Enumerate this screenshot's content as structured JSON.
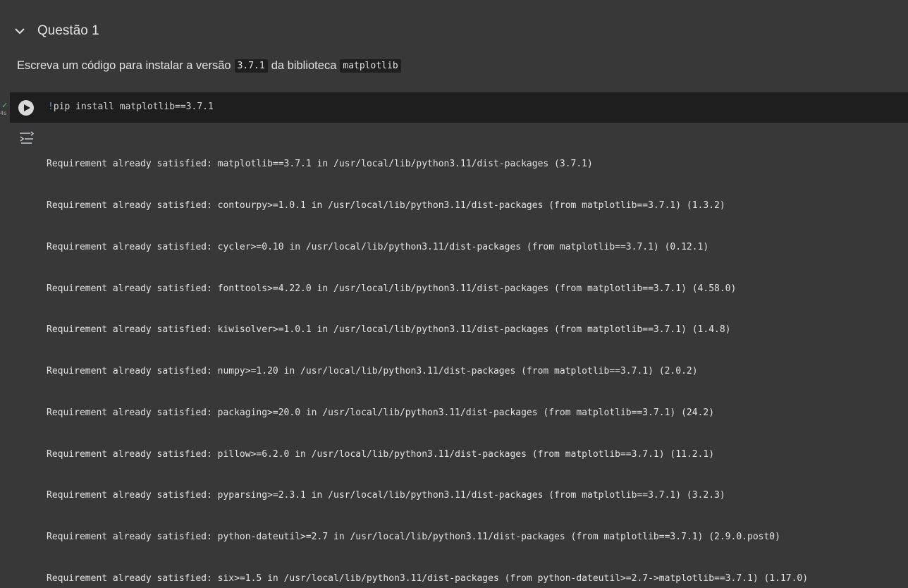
{
  "section": {
    "title": "Questão 1",
    "chevron_icon": "chevron-down-icon"
  },
  "text_cell": {
    "prefix": "Escreva um código para instalar a versão",
    "version_code": "3.7.1",
    "middle": "da biblioteca",
    "library_code": "matplotlib"
  },
  "execution": {
    "status_icon": "check-icon",
    "duration": "4s"
  },
  "code_cell": {
    "run_icon": "play-circle-icon",
    "bang": "!",
    "command": "pip install matplotlib==3.7.1"
  },
  "output": {
    "icon": "output-toggle-icon",
    "lines": [
      "Requirement already satisfied: matplotlib==3.7.1 in /usr/local/lib/python3.11/dist-packages (3.7.1)",
      "Requirement already satisfied: contourpy>=1.0.1 in /usr/local/lib/python3.11/dist-packages (from matplotlib==3.7.1) (1.3.2)",
      "Requirement already satisfied: cycler>=0.10 in /usr/local/lib/python3.11/dist-packages (from matplotlib==3.7.1) (0.12.1)",
      "Requirement already satisfied: fonttools>=4.22.0 in /usr/local/lib/python3.11/dist-packages (from matplotlib==3.7.1) (4.58.0)",
      "Requirement already satisfied: kiwisolver>=1.0.1 in /usr/local/lib/python3.11/dist-packages (from matplotlib==3.7.1) (1.4.8)",
      "Requirement already satisfied: numpy>=1.20 in /usr/local/lib/python3.11/dist-packages (from matplotlib==3.7.1) (2.0.2)",
      "Requirement already satisfied: packaging>=20.0 in /usr/local/lib/python3.11/dist-packages (from matplotlib==3.7.1) (24.2)",
      "Requirement already satisfied: pillow>=6.2.0 in /usr/local/lib/python3.11/dist-packages (from matplotlib==3.7.1) (11.2.1)",
      "Requirement already satisfied: pyparsing>=2.3.1 in /usr/local/lib/python3.11/dist-packages (from matplotlib==3.7.1) (3.2.3)",
      "Requirement already satisfied: python-dateutil>=2.7 in /usr/local/lib/python3.11/dist-packages (from matplotlib==3.7.1) (2.9.0.post0)",
      "Requirement already satisfied: six>=1.5 in /usr/local/lib/python3.11/dist-packages (from python-dateutil>=2.7->matplotlib==3.7.1) (1.17.0)"
    ]
  },
  "colors": {
    "page_background": "#383838",
    "code_background": "#1e1e1e",
    "text": "#e3e3e3",
    "success": "#5bb974",
    "keyword": "#569cd6"
  }
}
